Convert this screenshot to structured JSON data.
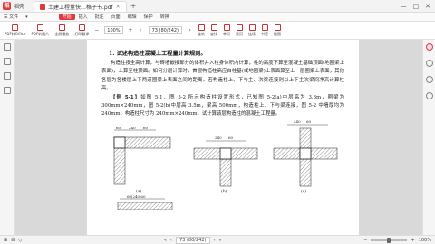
{
  "app": {
    "name": "稻壳",
    "logo_text": "稻"
  },
  "document_tab": {
    "title": "土建工程量快…格子书.pdf"
  },
  "window_controls": [
    "—",
    "□",
    "✕"
  ],
  "menu": {
    "items": [
      "☰ 文件",
      "▾"
    ],
    "active": "开始",
    "rest": [
      "插入",
      "批注",
      "页面",
      "编辑",
      "保护",
      "转换"
    ]
  },
  "ribbon": {
    "buttons": [
      {
        "label": "PDF转Office",
        "icon": "convert-icon"
      },
      {
        "label": "PDF转图片",
        "icon": "image-icon"
      },
      {
        "label": "全屏播放",
        "icon": "play-icon"
      },
      {
        "label": "打印翻译",
        "icon": "print-icon"
      }
    ],
    "zoom_value": "100%",
    "page_display": "73 (80/242)",
    "tools": [
      {
        "label": "旋转",
        "icon": "rotate-icon"
      },
      {
        "label": "查找",
        "icon": "search-icon"
      },
      {
        "label": "单页",
        "icon": "single-page-icon"
      },
      {
        "label": "双页",
        "icon": "double-page-icon"
      },
      {
        "label": "连续",
        "icon": "continuous-icon"
      },
      {
        "label": "书签",
        "icon": "bookmark-icon"
      },
      {
        "label": "截图",
        "icon": "screenshot-icon"
      }
    ]
  },
  "content": {
    "heading": "1. 试述构造柱混凝土工程量计算规则。",
    "para1": "构造柱按全高计算，与砖墙嵌接部分的体积并入柱身体积内计算，柱的高度下算至混凝土基础顶面(地圈梁上表面)，上算至柱顶面。如何分层计算时，首层构造柱高应自柱基(或地圈梁)上表面算至上一层圈梁上表面，其他各层为各楼层上下两道圈梁上表面之间的距离。若构造柱上、下与主、次梁连接则以上下主次梁间净高计算柱高。",
    "example_label": "【例 5-1】",
    "para2": "如图 5-1、图 5-2 所示构造柱设置形式，已知图 5-2(a)中层高为 3.3m，圈梁为 300mm×240mm，图 5-2(b)中层高 3.5m，梁高 500mm，构造柱上、下与梁连接，图 5-2 中墙厚均为 240mm，构造柱尺寸为 240mm×240mm，试计算该层构造柱的混凝土工程量。",
    "fig_a": "(a)",
    "fig_b": "(b)",
    "fig_c": "(c)",
    "dims": [
      "60",
      "240",
      "60",
      "240",
      "60",
      "240",
      "60",
      "60",
      "240",
      "60",
      "60|240|60"
    ]
  },
  "status": {
    "left": [
      "⊞",
      "⊟",
      "◇"
    ],
    "page": "73 (80/242)",
    "zoom": "100%"
  }
}
